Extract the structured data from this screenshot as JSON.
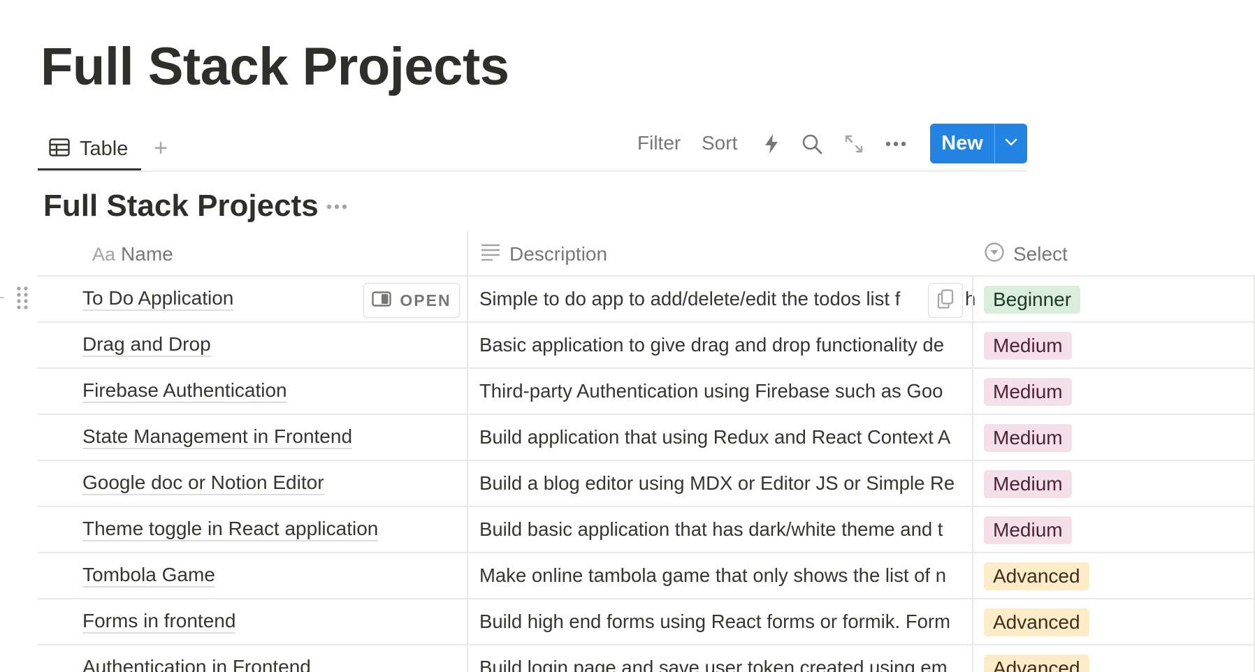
{
  "page": {
    "title": "Full Stack Projects"
  },
  "view_bar": {
    "tab_label": "Table",
    "add_view_symbol": "+",
    "filter_label": "Filter",
    "sort_label": "Sort",
    "icons": [
      "lightning-icon",
      "search-icon",
      "expand-icon",
      "more-icon"
    ],
    "new_label": "New"
  },
  "database": {
    "title": "Full Stack Projects",
    "more_icon": "more-icon"
  },
  "columns": [
    {
      "icon": "text-aa-icon",
      "icon_text": "Aa",
      "label": "Name"
    },
    {
      "icon": "text-lines-icon",
      "label": "Description"
    },
    {
      "icon": "select-icon",
      "label": "Select"
    }
  ],
  "row_actions": {
    "open_label": "OPEN"
  },
  "rows": [
    {
      "name": "To Do Application",
      "description": "Simple to do app to add/delete/edit the todos list f",
      "desc_tail": "h",
      "select": "Beginner"
    },
    {
      "name": "Drag and Drop",
      "description": "Basic application to give drag and drop functionality de",
      "select": "Medium"
    },
    {
      "name": "Firebase Authentication",
      "description": "Third-party Authentication using Firebase such as Goo",
      "select": "Medium"
    },
    {
      "name": "State Management in Frontend",
      "description": "Build application that using Redux and React Context A",
      "select": "Medium"
    },
    {
      "name": "Google doc or Notion Editor",
      "description": "Build a blog editor using MDX or Editor JS or Simple Re",
      "select": "Medium"
    },
    {
      "name": "Theme toggle in React application",
      "description": "Build basic application that has dark/white theme and t",
      "select": "Medium"
    },
    {
      "name": "Tombola Game",
      "description": "Make online tambola game that only shows the list of n",
      "select": "Advanced"
    },
    {
      "name": "Forms in frontend",
      "description": "Build high end forms using React forms or formik. Form",
      "select": "Advanced"
    },
    {
      "name": "Authentication in Frontend",
      "description": "Build login page and save user token created using em",
      "select": "Advanced"
    }
  ],
  "tag_colors": {
    "Beginner": {
      "bg": "#dbeddb",
      "fg": "#1c3829"
    },
    "Medium": {
      "bg": "#f5e0e9",
      "fg": "#4c2337"
    },
    "Advanced": {
      "bg": "#fdecc8",
      "fg": "#402c1b"
    }
  }
}
